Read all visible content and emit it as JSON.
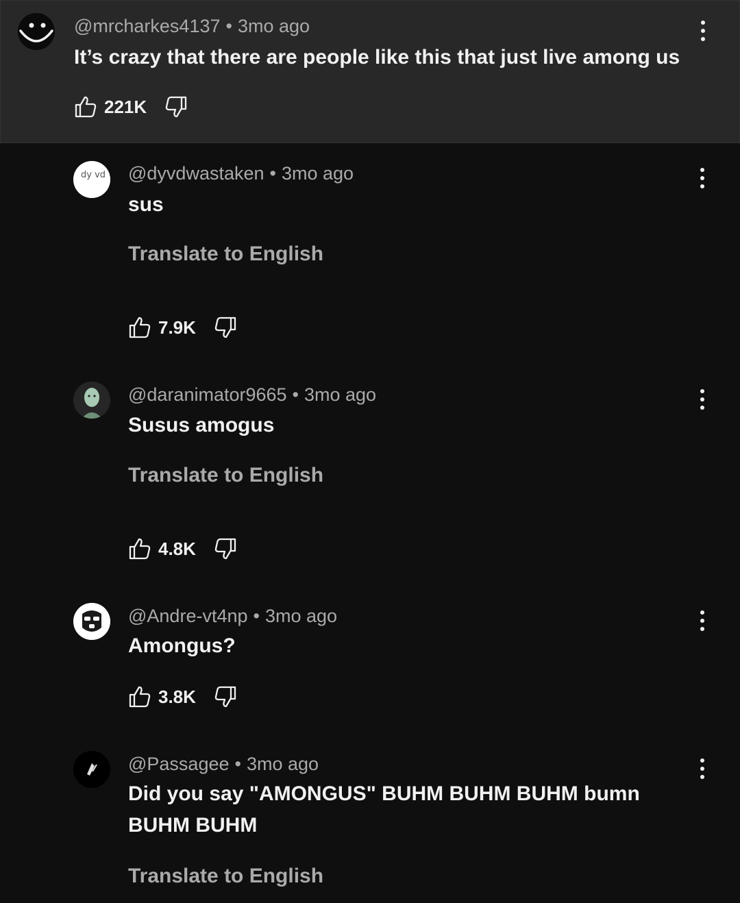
{
  "top_comment": {
    "handle": "@mrcharkes4137",
    "time": "3mo ago",
    "text": "It’s crazy that there are people like this that just live among us",
    "likes": "221K"
  },
  "replies": [
    {
      "handle": "@dyvdwastaken",
      "time": "3mo ago",
      "text": "sus",
      "translate": "Translate to English",
      "likes": "7.9K",
      "avatar_text": "dy vd"
    },
    {
      "handle": "@daranimator9665",
      "time": "3mo ago",
      "text": "Susus amogus",
      "translate": "Translate to English",
      "likes": "4.8K"
    },
    {
      "handle": "@Andre-vt4np",
      "time": "3mo ago",
      "text": "Amongus?",
      "likes": "3.8K"
    },
    {
      "handle": "@Passagee",
      "time": "3mo ago",
      "text": "Did you say \"AMONGUS\" BUHM BUHM BUHM bumn BUHM BUHM",
      "translate": "Translate to English"
    }
  ],
  "separator": "•",
  "icons": {
    "like": "thumbs-up-icon",
    "dislike": "thumbs-down-icon",
    "menu": "more-vert-icon"
  },
  "colors": {
    "background": "#0f0f0f",
    "highlight": "#282828",
    "text": "#f1f1f1",
    "secondary": "#aaaaaa"
  }
}
